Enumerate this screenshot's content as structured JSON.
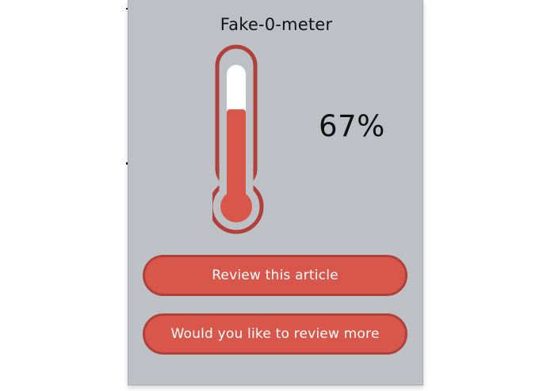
{
  "popup": {
    "title": "Fake-0-meter",
    "percent_text": "67%",
    "fake_level_fraction": 0.67
  },
  "buttons": {
    "review_label": "Review this article",
    "more_label": "Would you like to review more"
  },
  "colors": {
    "panel_bg": "#bdc1c5",
    "accent": "#d9564a",
    "accent_border": "#b0403a",
    "tube_empty": "#ffffff"
  }
}
